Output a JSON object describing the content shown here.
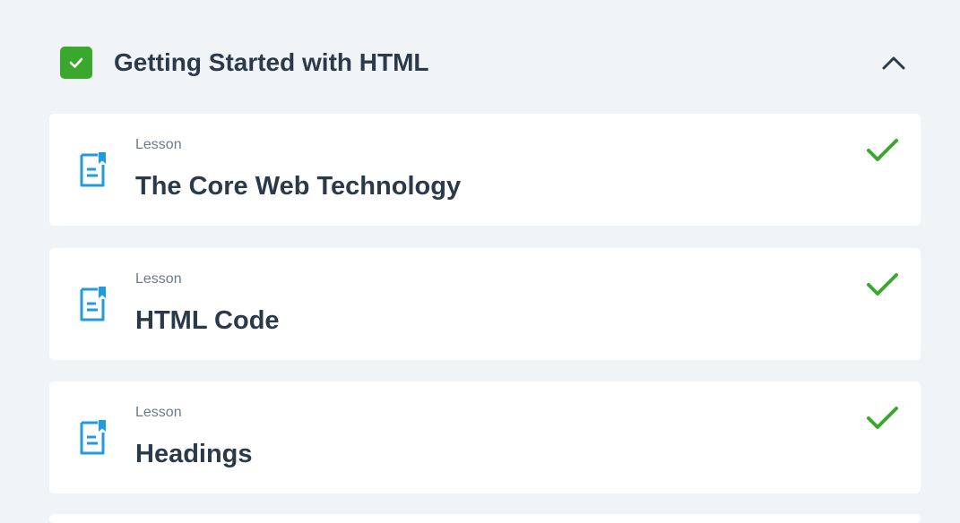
{
  "section": {
    "title": "Getting Started with HTML",
    "completed": true,
    "expanded": true
  },
  "lessons": [
    {
      "type": "Lesson",
      "title": "The Core Web Technology",
      "completed": true
    },
    {
      "type": "Lesson",
      "title": "HTML Code",
      "completed": true
    },
    {
      "type": "Lesson",
      "title": "Headings",
      "completed": true
    }
  ],
  "colors": {
    "background": "#f1f4f7",
    "card": "#ffffff",
    "success_green": "#3aa82d",
    "icon_blue": "#1f9bde",
    "text_dark": "#2b3a4a",
    "text_muted": "#6c7b8a"
  },
  "icons": {
    "section_status": "checkbox-checked-icon",
    "toggle": "chevron-up-icon",
    "lesson": "document-bookmark-icon",
    "lesson_status": "checkmark-icon"
  }
}
